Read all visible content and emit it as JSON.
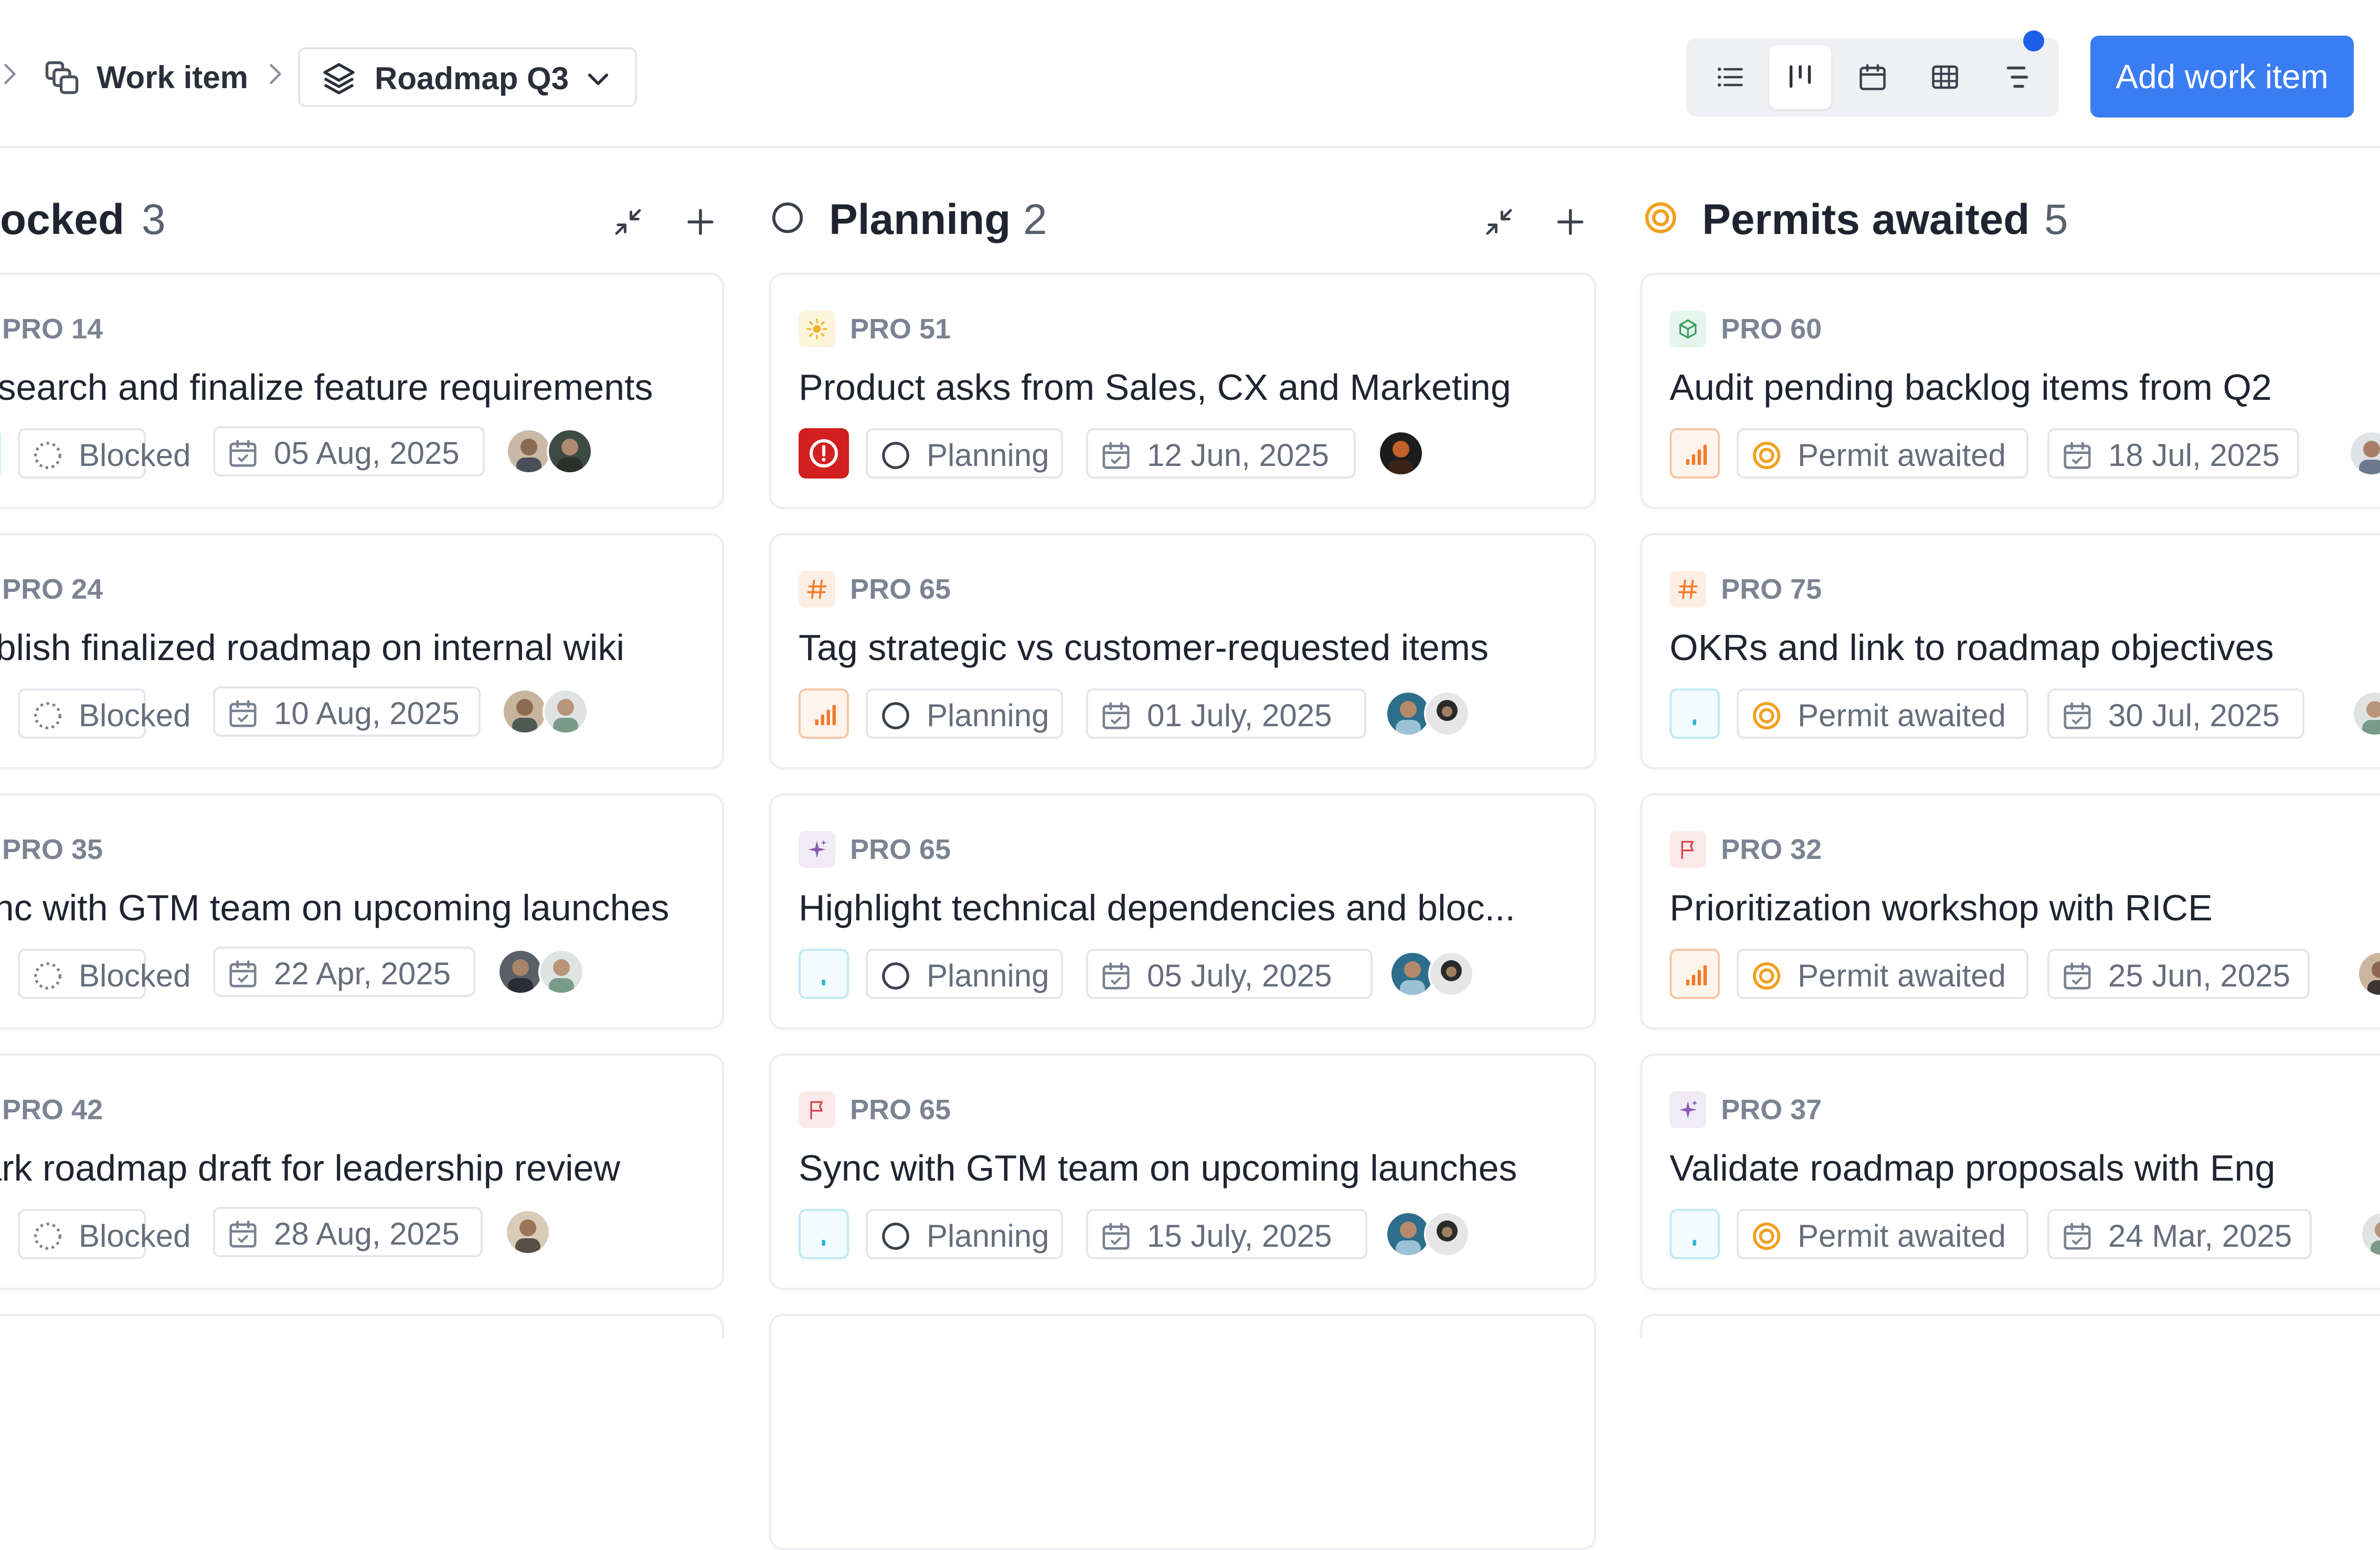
{
  "header": {
    "breadcrumb": "Work item",
    "project": "Roadmap Q3",
    "add_button": "Add work item",
    "views": [
      "list-icon",
      "board-icon",
      "calendar-icon",
      "spreadsheet-icon",
      "gantt-icon"
    ]
  },
  "colors": {
    "accent": "#3a7cf2",
    "urgent": "#d21f1f",
    "high": "#f27a2a",
    "low": "#2fb6d6",
    "permit": "#f2a01f"
  },
  "columns": [
    {
      "title": "Blocked",
      "count": "3",
      "cards": [
        {
          "id": "PRO 14",
          "title": "Research and finalize feature requirements",
          "status": "Blocked",
          "date": "05 Aug, 2025"
        },
        {
          "id": "PRO 24",
          "title": "Publish finalized roadmap on internal wiki",
          "status": "Blocked",
          "date": "10 Aug, 2025"
        },
        {
          "id": "PRO 35",
          "title": "Sync with GTM team on upcoming launches",
          "status": "Blocked",
          "date": "22 Apr, 2025"
        },
        {
          "id": "PRO 42",
          "title": "Mark roadmap draft for leadership review",
          "status": "Blocked",
          "date": "28 Aug, 2025"
        }
      ]
    },
    {
      "title": "Planning",
      "count": "2",
      "cards": [
        {
          "id": "PRO 51",
          "title": "Product asks from Sales, CX and Marketing",
          "status": "Planning",
          "date": "12 Jun, 2025",
          "type": "sun-icon",
          "priority": "urgent"
        },
        {
          "id": "PRO 65",
          "title": "Tag strategic vs customer-requested items",
          "status": "Planning",
          "date": "01 July, 2025",
          "type": "hash-icon",
          "priority": "high"
        },
        {
          "id": "PRO 65",
          "title": "Highlight technical dependencies and bloc...",
          "status": "Planning",
          "date": "05 July, 2025",
          "type": "sparkle-icon",
          "priority": "low"
        },
        {
          "id": "PRO 65",
          "title": "Sync with GTM team on upcoming launches",
          "status": "Planning",
          "date": "15 July, 2025",
          "type": "flag-icon",
          "priority": "low"
        }
      ]
    },
    {
      "title": "Permits awaited",
      "count": "5",
      "cards": [
        {
          "id": "PRO 60",
          "title": "Audit pending backlog items from Q2",
          "status": "Permit awaited",
          "date": "18 Jul, 2025",
          "type": "cube-icon",
          "priority": "high"
        },
        {
          "id": "PRO 75",
          "title": "OKRs and link to roadmap objectives",
          "status": "Permit awaited",
          "date": "30 Jul, 2025",
          "type": "hash-icon",
          "priority": "low"
        },
        {
          "id": "PRO 32",
          "title": "Prioritization workshop with RICE",
          "status": "Permit awaited",
          "date": "25 Jun, 2025",
          "type": "flag-icon",
          "priority": "high"
        },
        {
          "id": "PRO 37",
          "title": "Validate roadmap proposals with Eng",
          "status": "Permit awaited",
          "date": "24 Mar, 2025",
          "type": "sparkle-icon",
          "priority": "low"
        }
      ]
    }
  ]
}
